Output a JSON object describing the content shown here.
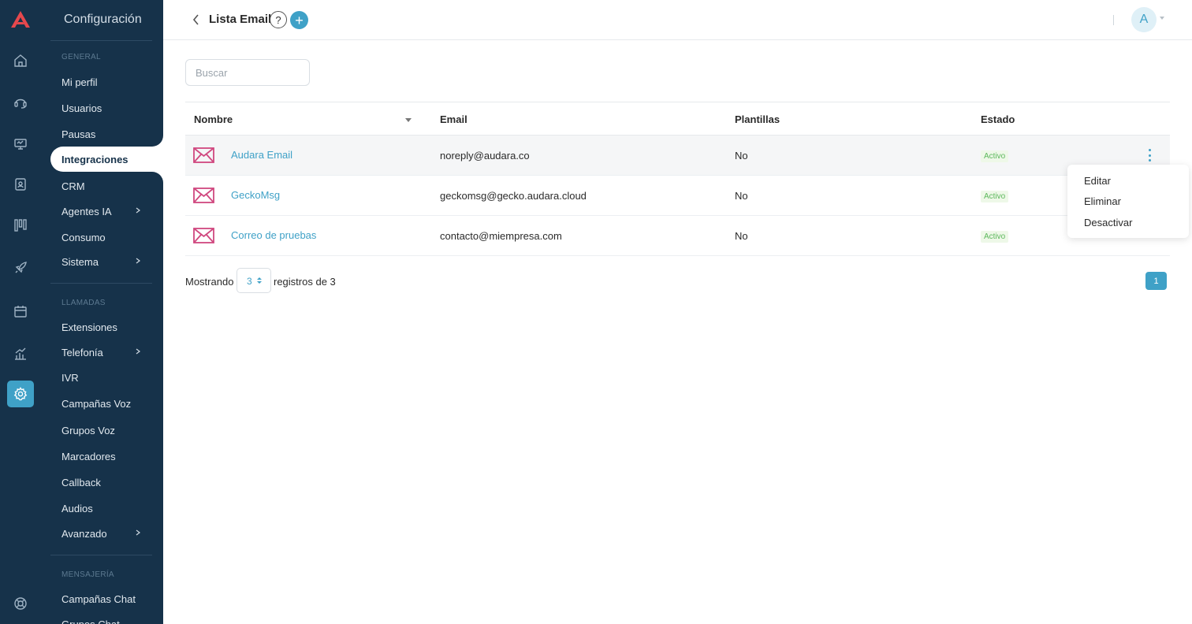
{
  "sidebar": {
    "title": "Configuración",
    "sections": {
      "general": "GENERAL",
      "calls": "LLAMADAS",
      "messaging": "MENSAJERÍA"
    },
    "items": {
      "profile": "Mi perfil",
      "users": "Usuarios",
      "pauses": "Pausas",
      "integrations": "Integraciones",
      "crm": "CRM",
      "ai_agents": "Agentes IA",
      "consumption": "Consumo",
      "system": "Sistema",
      "extensions": "Extensiones",
      "telephony": "Telefonía",
      "ivr": "IVR",
      "voice_campaigns": "Campañas Voz",
      "voice_groups": "Grupos Voz",
      "dialers": "Marcadores",
      "callback": "Callback",
      "audios": "Audios",
      "advanced": "Avanzado",
      "chat_campaigns": "Campañas Chat",
      "chat_groups": "Grupos Chat"
    },
    "active_item": "Integraciones"
  },
  "rail_icons": [
    "home-icon",
    "headset-icon",
    "monitor-icon",
    "contacts-icon",
    "kanban-icon",
    "rocket-icon",
    "calendar-icon",
    "analytics-icon",
    "settings-icon",
    "support-icon"
  ],
  "header": {
    "title": "Lista Email",
    "help_label": "?",
    "add_label": "+",
    "avatar_initial": "A"
  },
  "search": {
    "placeholder": "Buscar",
    "value": ""
  },
  "table": {
    "columns": {
      "name": "Nombre",
      "email": "Email",
      "templates": "Plantillas",
      "status": "Estado"
    },
    "rows": [
      {
        "name": "Audara Email",
        "email": "noreply@audara.co",
        "templates": "No",
        "status": "Activo"
      },
      {
        "name": "GeckoMsg",
        "email": "geckomsg@gecko.audara.cloud",
        "templates": "No",
        "status": "Activo"
      },
      {
        "name": "Correo de pruebas",
        "email": "contacto@miempresa.com",
        "templates": "No",
        "status": "Activo"
      }
    ]
  },
  "pagination": {
    "showing_label": "Mostrando",
    "page_size": "3",
    "records_label": "registros de 3",
    "current_page": "1"
  },
  "row_menu": {
    "edit": "Editar",
    "delete": "Eliminar",
    "deactivate": "Desactivar"
  },
  "colors": {
    "sidebar_bg": "#16324a",
    "accent": "#3fa1c7",
    "mail_icon": "#d0487f",
    "status_active": "#5cb85c"
  }
}
